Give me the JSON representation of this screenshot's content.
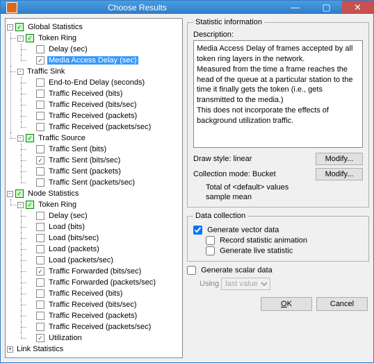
{
  "window": {
    "title": "Choose Results"
  },
  "titlebar": {
    "minimize": "—",
    "maximize": "▢",
    "close": "✕"
  },
  "tree": {
    "global_stats": "Global Statistics",
    "token_ring": "Token Ring",
    "delay_sec": "Delay (sec)",
    "media_access_delay": "Media Access Delay (sec)",
    "traffic_sink": "Traffic Sink",
    "end_to_end_delay": "End-to-End Delay (seconds)",
    "traffic_received_bits": "Traffic Received (bits)",
    "traffic_received_bitssec": "Traffic Received (bits/sec)",
    "traffic_received_packets": "Traffic Received (packets)",
    "traffic_received_packetssec": "Traffic Received (packets/sec)",
    "traffic_source": "Traffic Source",
    "traffic_sent_bits": "Traffic Sent (bits)",
    "traffic_sent_bitssec": "Traffic Sent (bits/sec)",
    "traffic_sent_packets": "Traffic Sent (packets)",
    "traffic_sent_packetssec": "Traffic Sent (packets/sec)",
    "node_stats": "Node Statistics",
    "load_bits": "Load (bits)",
    "load_bitssec": "Load (bits/sec)",
    "load_packets": "Load (packets)",
    "load_packetssec": "Load (packets/sec)",
    "traffic_forwarded_bitssec": "Traffic Forwarded (bits/sec)",
    "traffic_forwarded_packetssec": "Traffic Forwarded (packets/sec)",
    "utilization": "Utilization",
    "link_stats": "Link Statistics"
  },
  "stat_info": {
    "legend": "Statistic information",
    "desc_label": "Description:",
    "desc_text": "Media Access Delay of frames accepted by all token ring layers in the network.\nMeasured from the time a frame reaches the head of the queue at a particular station to the time it finally gets the token (i.e., gets transmitted to the media.)\nThis does not incorporate the effects of background utilization traffic.",
    "draw_style_label": "Draw style:",
    "draw_style_value": "linear",
    "modify": "Modify...",
    "collection_mode_label": "Collection mode:",
    "collection_mode_value": "Bucket",
    "collection_sub1": "Total of <default> values",
    "collection_sub2": "sample mean"
  },
  "data_coll": {
    "legend": "Data collection",
    "gen_vector": "Generate vector data",
    "rec_stat_anim": "Record statistic animation",
    "gen_live": "Generate live statistic"
  },
  "scalar": {
    "label": "Generate scalar data",
    "using": "Using",
    "option": "last value"
  },
  "buttons": {
    "ok": "OK",
    "cancel": "Cancel"
  }
}
